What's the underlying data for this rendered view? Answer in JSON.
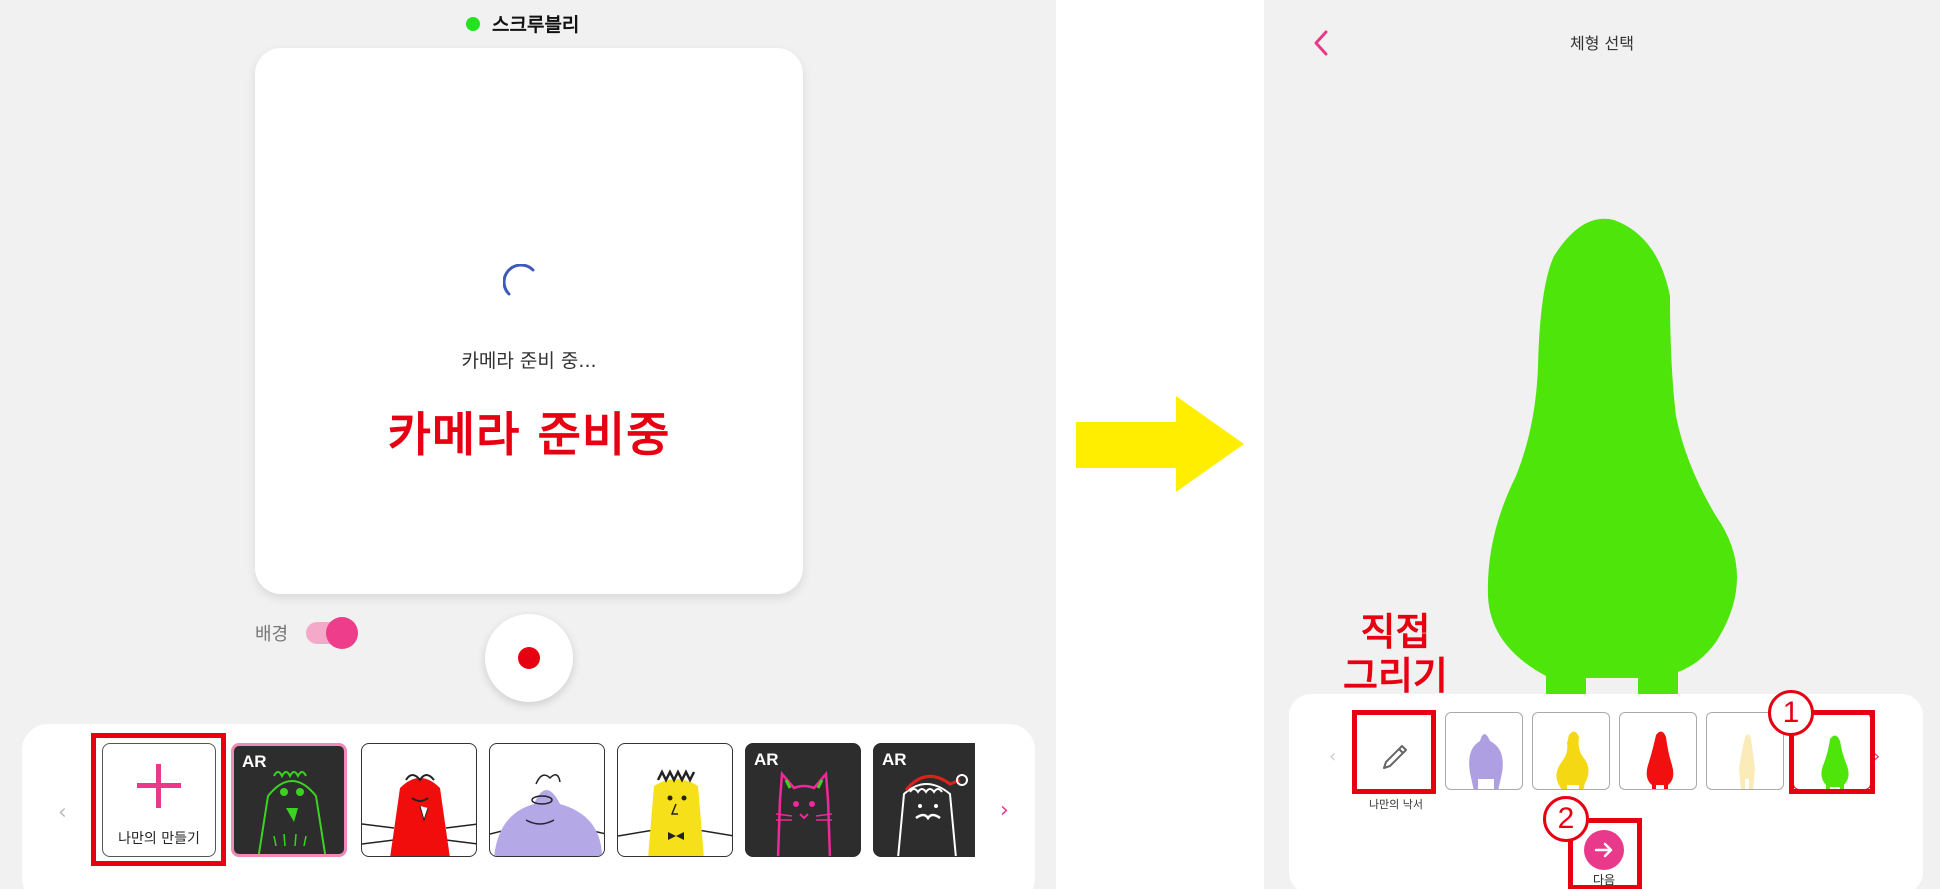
{
  "left": {
    "status_label": "스크루블리",
    "camera_status": "카메라 준비 중...",
    "camera_annotation": "카메라 준비중",
    "background_label": "배경",
    "background_toggle_on": true,
    "make_own_label": "나만의 만들기",
    "ar_badge": "AR",
    "templates": [
      {
        "name": "green-monster",
        "ar": true,
        "colors": {
          "bg": "#2d2d2d",
          "fill": "#3bd321"
        }
      },
      {
        "name": "red-hairy",
        "ar": false,
        "colors": {
          "bg": "#ffffff",
          "fill": "#f20d0d"
        }
      },
      {
        "name": "purple-blob",
        "ar": false,
        "colors": {
          "bg": "#ffffff",
          "fill": "#b4a8e6"
        }
      },
      {
        "name": "yellow-guy",
        "ar": false,
        "colors": {
          "bg": "#ffffff",
          "fill": "#f6e01a"
        }
      },
      {
        "name": "pink-cat",
        "ar": true,
        "colors": {
          "bg": "#2d2d2d",
          "fill": "#f0289a"
        }
      },
      {
        "name": "santa-white",
        "ar": true,
        "colors": {
          "bg": "#2d2d2d",
          "fill": "#ffffff"
        }
      }
    ]
  },
  "right": {
    "title": "체형 선택",
    "draw_annotation_line1": "직접",
    "draw_annotation_line2": "그리기",
    "pencil_label": "나만의 낙서",
    "next_label": "다음",
    "step1": "1",
    "step2": "2",
    "shapes": [
      {
        "name": "purple-shape",
        "color": "#ad9fe2"
      },
      {
        "name": "yellow-shape",
        "color": "#f3d813"
      },
      {
        "name": "red-shape",
        "color": "#f20f0f"
      },
      {
        "name": "cream-shape",
        "color": "#fbebb9"
      },
      {
        "name": "green-shape",
        "color": "#4ee50a"
      }
    ],
    "selected_shape_color": "#4ee50a"
  },
  "colors": {
    "accent_pink": "#e8398a",
    "annotation_red": "#e60012",
    "arrow_yellow": "#ffee00"
  }
}
